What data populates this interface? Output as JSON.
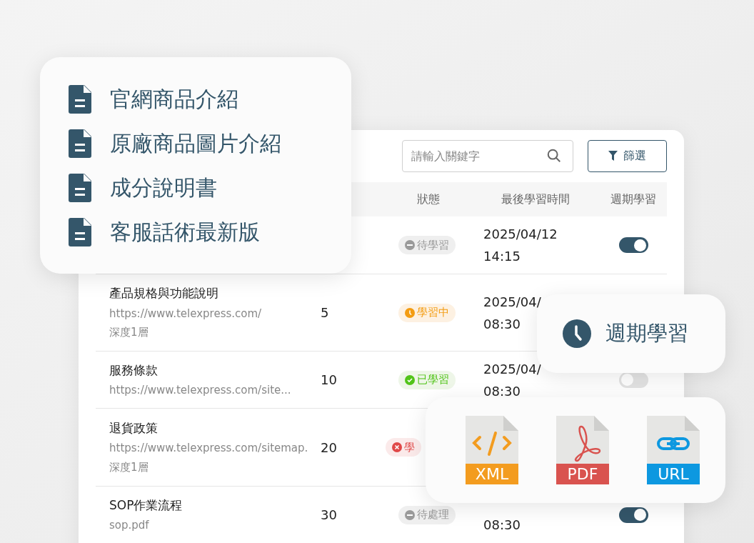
{
  "doc_list": {
    "items": [
      "官網商品介紹",
      "原廠商品圖片介紹",
      "成分說明書",
      "客服話術最新版"
    ]
  },
  "table": {
    "search": {
      "placeholder": "請輸入關鍵字"
    },
    "filter_button": "篩選",
    "columns": [
      "狀態",
      "最後學習時間",
      "週期學習"
    ],
    "rows": [
      {
        "status": {
          "kind": "pending",
          "label": "待學習"
        },
        "date": "2025/04/12",
        "time": "14:15",
        "cycle_on": true
      },
      {
        "title": "產品規格與功能說明",
        "url": "https://www.telexpress.com/",
        "depth": "深度1層",
        "count": "5",
        "status": {
          "kind": "learning",
          "label": "學習中"
        },
        "date": "2025/04/",
        "time": "08:30"
      },
      {
        "title": "服務條款",
        "url": "https://www.telexpress.com/site...",
        "count": "10",
        "status": {
          "kind": "learned",
          "label": "已學習"
        },
        "date": "2025/04/",
        "time": "08:30",
        "cycle_on": false
      },
      {
        "title": "退貨政策",
        "url": "https://www.telexpress.com/sitemap.",
        "depth": "深度1層",
        "count": "20",
        "status": {
          "kind": "failed",
          "label": "學"
        }
      },
      {
        "title": "SOP作業流程",
        "url": "sop.pdf",
        "count": "30",
        "status": {
          "kind": "pending",
          "label": "待處理"
        },
        "time": "08:30",
        "cycle_on": true
      }
    ]
  },
  "schedule_card": {
    "label": "週期學習"
  },
  "file_types": [
    {
      "kind": "xml",
      "label": "XML"
    },
    {
      "kind": "pdf",
      "label": "PDF"
    },
    {
      "kind": "url",
      "label": "URL"
    }
  ]
}
